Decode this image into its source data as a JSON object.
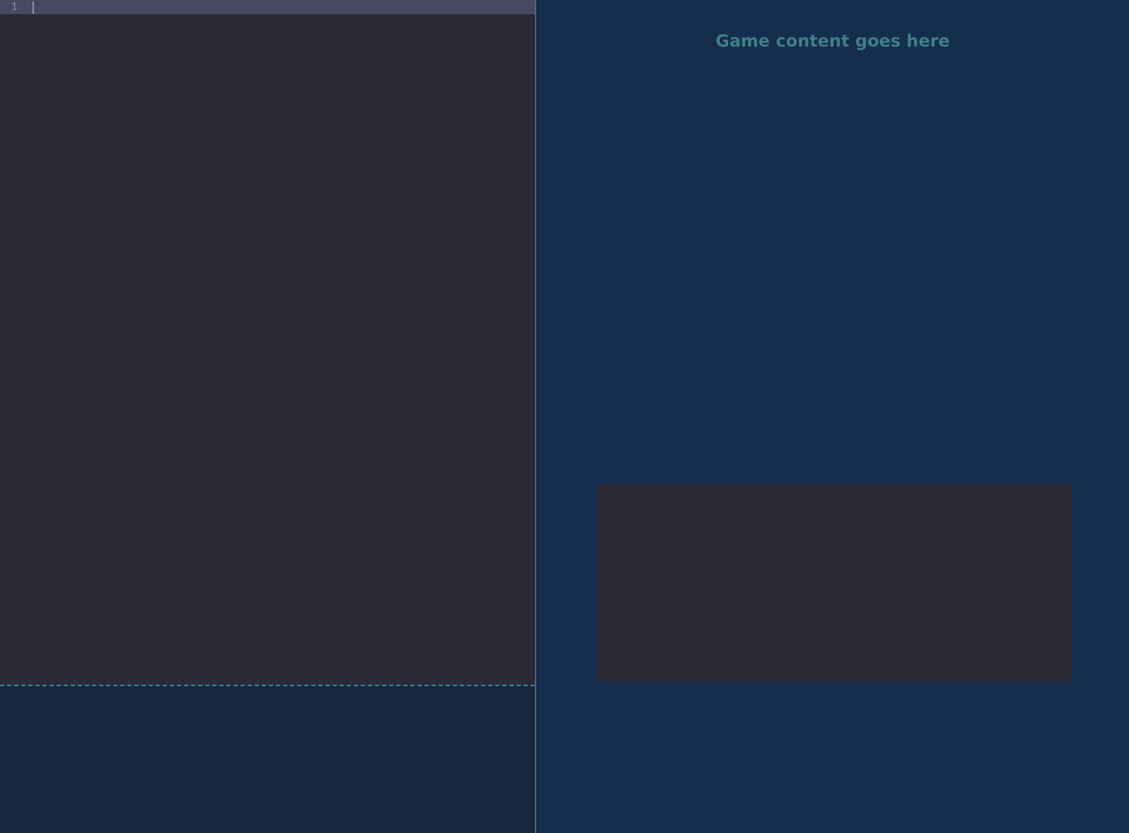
{
  "editor": {
    "lines": [
      {
        "number": "1",
        "current": true
      }
    ]
  },
  "game": {
    "message": "Game content goes here"
  }
}
